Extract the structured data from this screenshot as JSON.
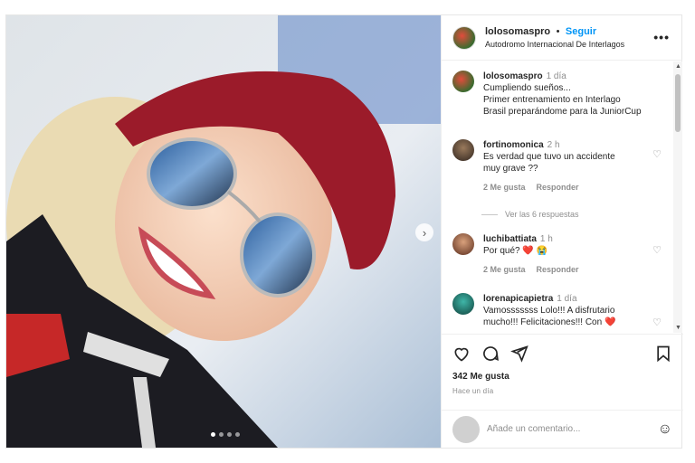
{
  "post": {
    "username": "lolosomaspro",
    "separator": "•",
    "follow_label": "Seguir",
    "location": "Autodromo Internacional De Interlagos",
    "more_label": "•••",
    "next_label": "›"
  },
  "caption": {
    "user": "lolosomaspro",
    "time": "1 día",
    "text": "Cumpliendo sueños...\nPrimer entrenamiento en Interlago\nBrasil preparándome para la JuniorCup"
  },
  "comments": [
    {
      "user": "fortinomonica",
      "time": "2 h",
      "text": "Es verdad que tuvo un accidente\nmuy grave ??",
      "likes": "2 Me gusta",
      "reply": "Responder"
    },
    {
      "user": "luchibattiata",
      "time": "1 h",
      "text": "Por qué? ❤️ 😭",
      "likes": "2 Me gusta",
      "reply": "Responder"
    },
    {
      "user": "lorenapicapietra",
      "time": "1 día",
      "text": "Vamosssssss Lolo!!! A disfrutario\nmucho!!! Felicitaciones!!! Con ❤️"
    }
  ],
  "view_replies": "Ver las 6 respuestas",
  "likes_count": "342 Me gusta",
  "time_ago": "Hace un día",
  "add_comment": {
    "placeholder": "Añade un comentario..."
  },
  "icons": [
    "heart-icon",
    "comment-icon",
    "share-icon",
    "bookmark-icon",
    "emoji-icon",
    "more-icon",
    "chevron-right-icon"
  ],
  "carousel": {
    "count": 4,
    "active": 0
  }
}
